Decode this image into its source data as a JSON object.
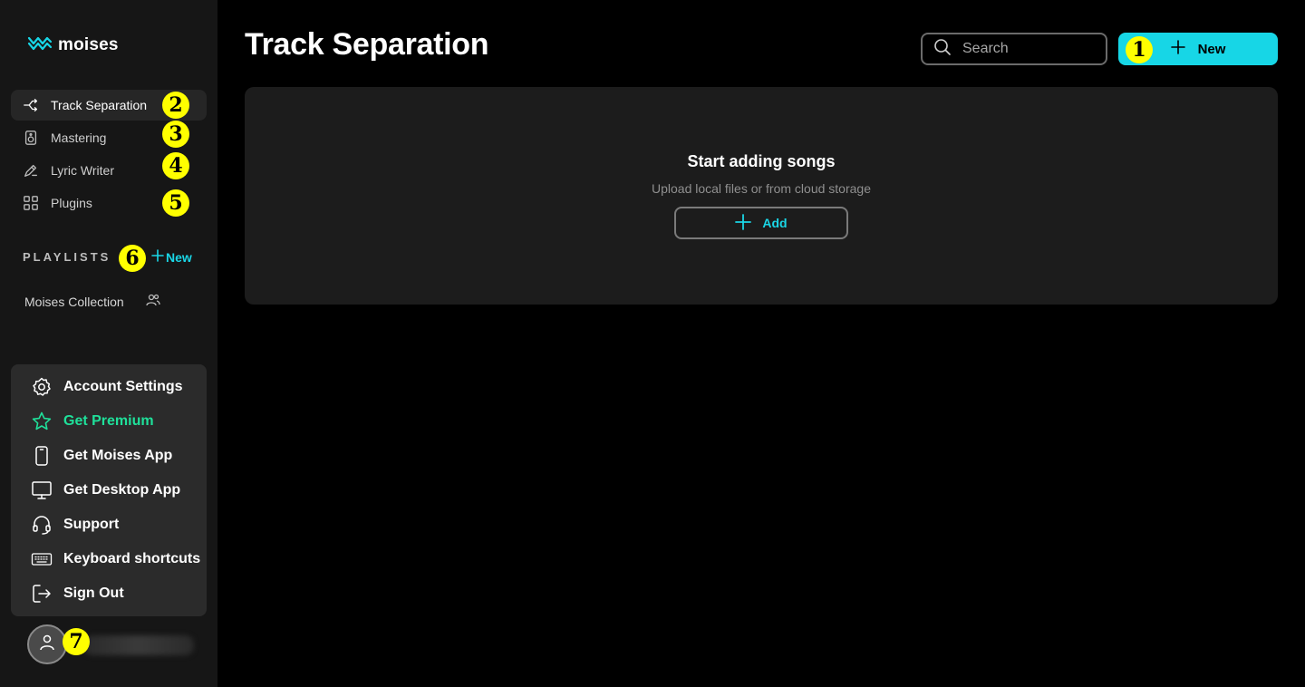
{
  "brand": {
    "name": "moises",
    "accent": "#17d6e6",
    "premium_color": "#1fe09a",
    "badge_color": "#ffff00"
  },
  "sidebar": {
    "items": [
      {
        "label": "Track Separation",
        "icon": "split-arrows-icon",
        "active": true
      },
      {
        "label": "Mastering",
        "icon": "speaker-icon"
      },
      {
        "label": "Lyric Writer",
        "icon": "pen-icon"
      },
      {
        "label": "Plugins",
        "icon": "grid-icon"
      }
    ],
    "playlists": {
      "header": "PLAYLISTS",
      "new_label": "New",
      "items": [
        {
          "label": "Moises Collection",
          "icon": "people-icon"
        }
      ]
    }
  },
  "account_menu": {
    "items": [
      {
        "label": "Account Settings",
        "icon": "gear-icon"
      },
      {
        "label": "Get Premium",
        "icon": "star-icon"
      },
      {
        "label": "Get Moises App",
        "icon": "phone-icon"
      },
      {
        "label": "Get Desktop App",
        "icon": "monitor-icon"
      },
      {
        "label": "Support",
        "icon": "headset-icon"
      },
      {
        "label": "Keyboard shortcuts",
        "icon": "keyboard-icon"
      },
      {
        "label": "Sign Out",
        "icon": "sign-out-icon"
      }
    ]
  },
  "header": {
    "title": "Track Separation",
    "search_placeholder": "Search",
    "new_button": "New"
  },
  "empty_state": {
    "title": "Start adding songs",
    "subtitle": "Upload local files or from cloud storage",
    "add_button": "Add"
  },
  "annotations": [
    "1",
    "2",
    "3",
    "4",
    "5",
    "6",
    "7"
  ]
}
